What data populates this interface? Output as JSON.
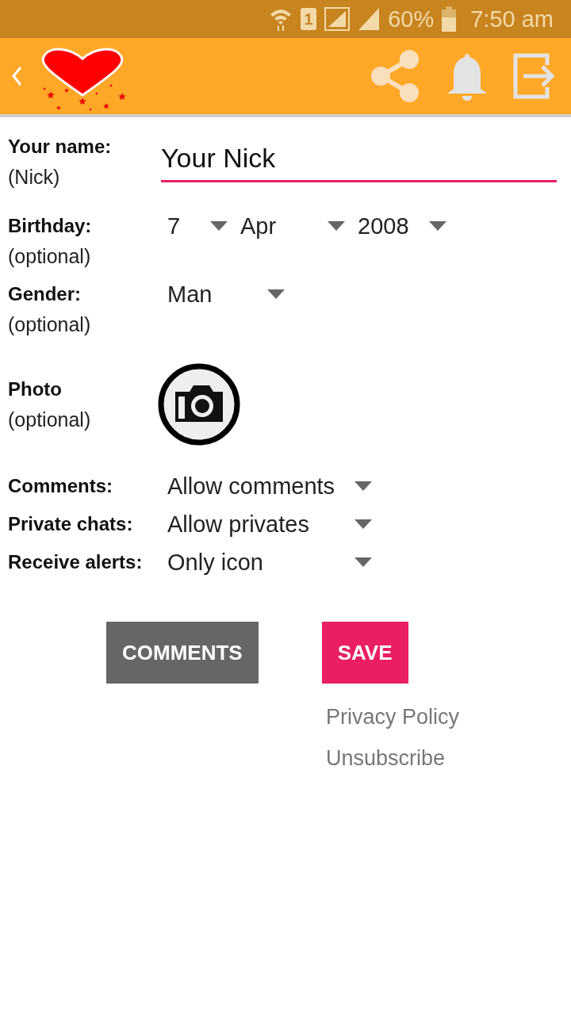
{
  "status_bar": {
    "sim": "1",
    "battery": "60%",
    "time": "7:50 am"
  },
  "form": {
    "name": {
      "label": "Your name:",
      "hint": "(Nick)",
      "value": "Your Nick"
    },
    "birthday": {
      "label": "Birthday:",
      "hint": "(optional)",
      "day": "7",
      "month": "Apr",
      "year": "2008"
    },
    "gender": {
      "label": "Gender:",
      "hint": "(optional)",
      "value": "Man"
    },
    "photo": {
      "label": "Photo",
      "hint": "(optional)"
    },
    "settings": [
      {
        "label": "Comments:",
        "value": "Allow comments"
      },
      {
        "label": "Private chats:",
        "value": "Allow privates"
      },
      {
        "label": "Receive alerts:",
        "value": "Only icon"
      }
    ]
  },
  "buttons": [
    {
      "label": "COMMENTS",
      "kind": "secondary"
    },
    {
      "label": "SAVE",
      "kind": "primary"
    }
  ],
  "links": [
    "Privacy Policy",
    "Unsubscribe"
  ]
}
